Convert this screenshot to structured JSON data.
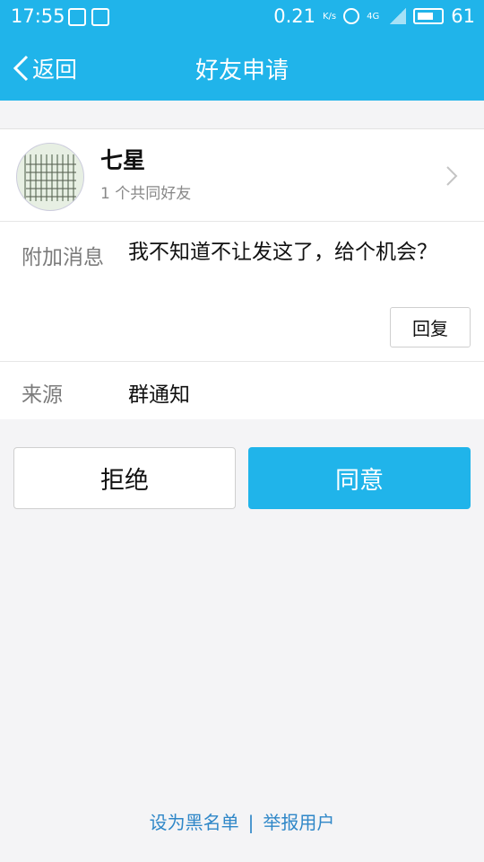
{
  "statusbar": {
    "time": "17:55",
    "speed": "0.21",
    "speed_unit": "K/s",
    "network": "4G",
    "battery": "61"
  },
  "nav": {
    "back_label": "返回",
    "title": "好友申请"
  },
  "profile": {
    "name": "七星",
    "mutual": "1 个共同好友"
  },
  "message": {
    "label": "附加消息",
    "text": "我不知道不让发这了，给个机会？",
    "reply_label": "回复"
  },
  "source": {
    "label": "来源",
    "value": "群通知"
  },
  "actions": {
    "reject_label": "拒绝",
    "accept_label": "同意"
  },
  "footer": {
    "blacklist_label": "设为黑名单",
    "separator": "|",
    "report_label": "举报用户"
  },
  "colors": {
    "accent": "#20b4ea",
    "link": "#2f87c8"
  }
}
